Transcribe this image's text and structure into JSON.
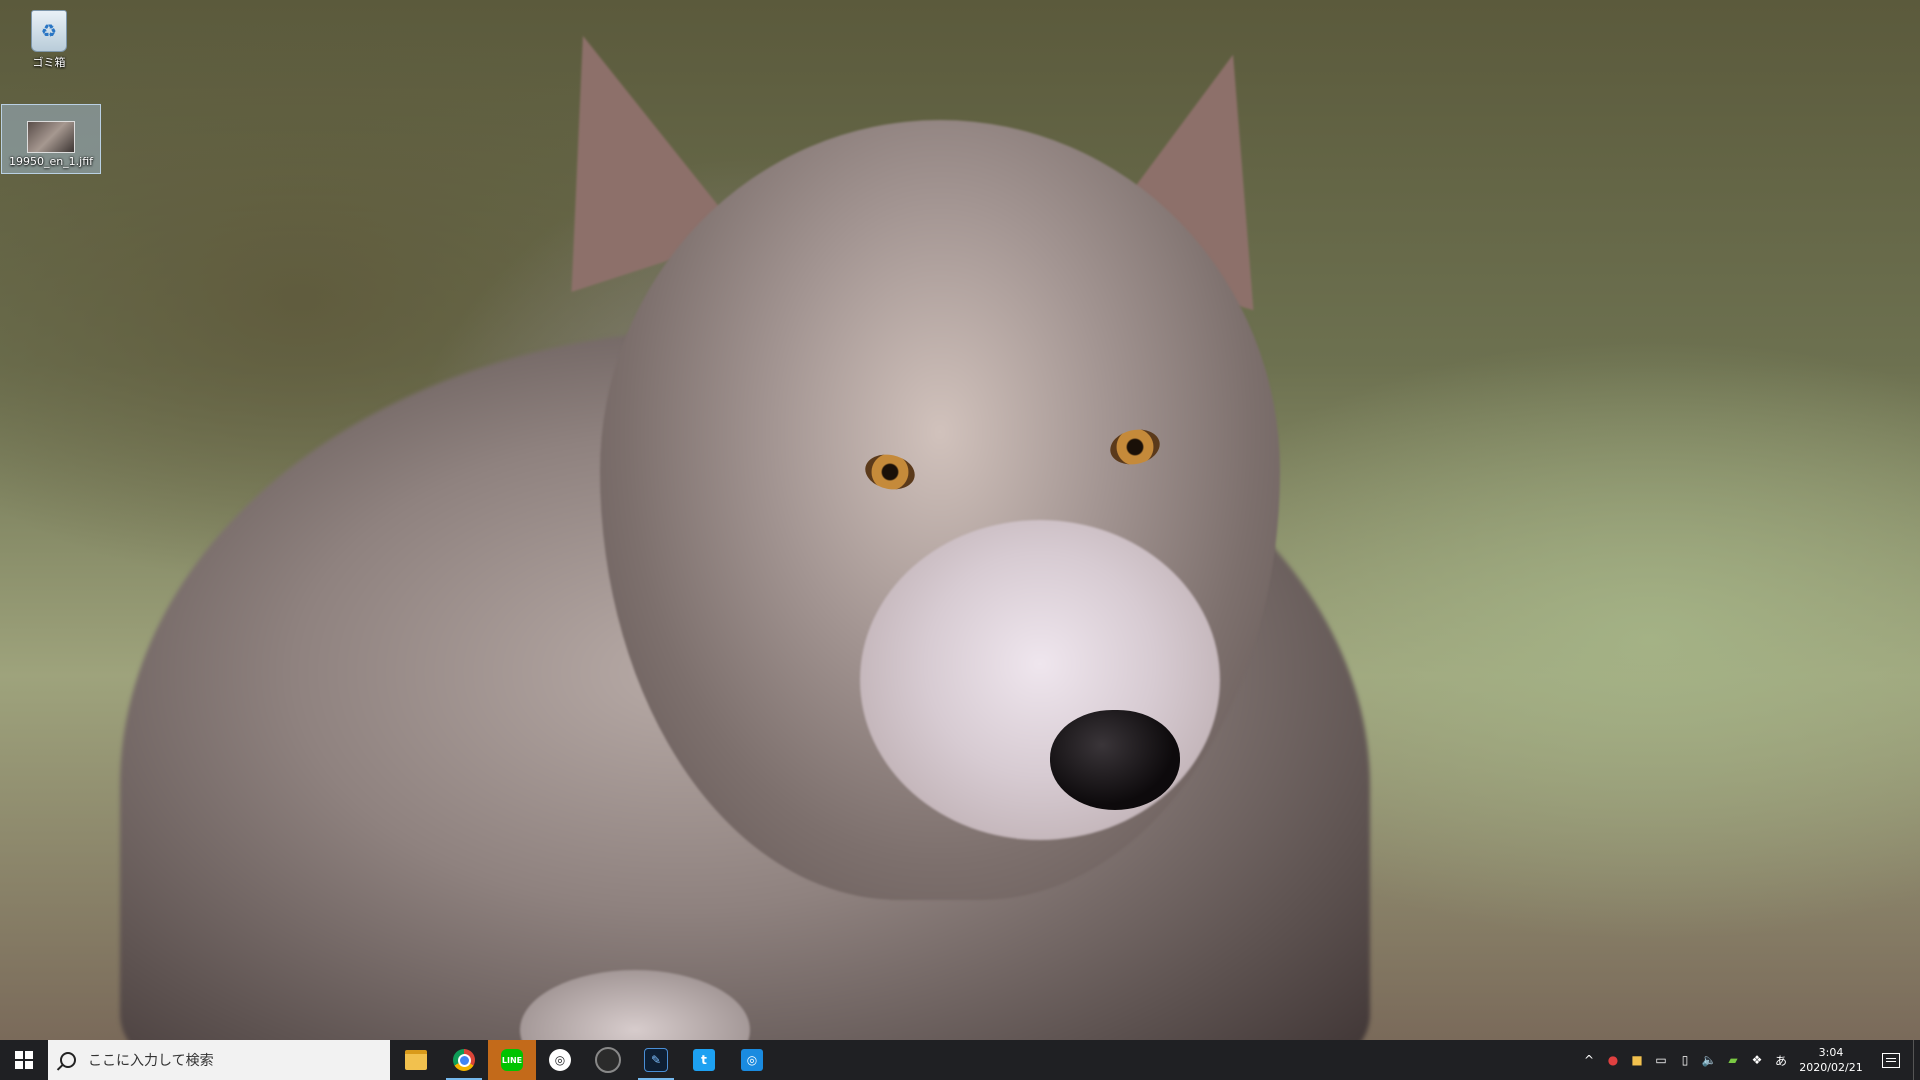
{
  "desktop": {
    "icons": [
      {
        "label": "ゴミ箱",
        "icon": "recycle-bin-icon"
      },
      {
        "label": "19950_en_1.jfif",
        "icon": "image-file-icon"
      }
    ]
  },
  "taskbar": {
    "search": {
      "placeholder": "ここに入力して検索"
    },
    "pinned": [
      {
        "name": "file-explorer",
        "icon": "folder-icon",
        "glyph": ""
      },
      {
        "name": "chrome",
        "icon": "chrome-icon",
        "glyph": ""
      },
      {
        "name": "line",
        "icon": "line-icon",
        "glyph": "LINE"
      },
      {
        "name": "steam",
        "icon": "steam-icon",
        "glyph": "◎"
      },
      {
        "name": "davinci-resolve",
        "icon": "davinci-resolve-icon",
        "glyph": "⁂"
      },
      {
        "name": "app-dark",
        "icon": "app-icon",
        "glyph": "✎"
      },
      {
        "name": "twitter",
        "icon": "twitter-icon",
        "glyph": "🐦"
      },
      {
        "name": "app-blue",
        "icon": "app-icon",
        "glyph": "◎"
      }
    ],
    "tray": {
      "ime": "あ",
      "time": "3:04",
      "date": "2020/02/21"
    }
  }
}
